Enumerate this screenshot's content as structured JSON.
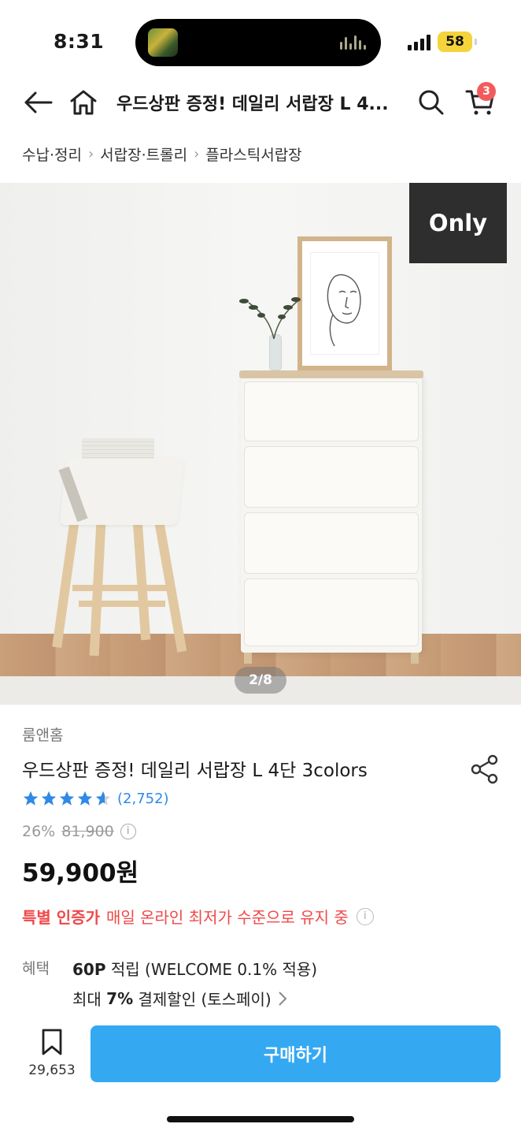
{
  "status_bar": {
    "time": "8:31",
    "battery": "58"
  },
  "header": {
    "title": "우드상판 증정! 데일리 서랍장 L 4...",
    "cart_count": "3"
  },
  "breadcrumb": [
    "수납·정리",
    "서랍장·트롤리",
    "플라스틱서랍장"
  ],
  "gallery": {
    "badge": "Only",
    "pager": "2/8"
  },
  "product": {
    "seller": "룸앤홈",
    "name": "우드상판 증정! 데일리 서랍장 L 4단 3colors",
    "rating": 4.5,
    "review_count": "(2,752)",
    "discount": "26%",
    "original_price": "81,900",
    "price": "59,900원",
    "promo_strong": "특별 인증가",
    "promo_text": "매일 온라인 최저가 수준으로 유지 중",
    "benefit_label": "혜택",
    "points_bold": "60P",
    "points_text": "적립 (WELCOME 0.1% 적용)",
    "payment_pre": "최대",
    "payment_bold": "7%",
    "payment_text": "결제할인 (토스페이)"
  },
  "bottom_bar": {
    "bookmark_count": "29,653",
    "buy_label": "구매하기"
  },
  "colors": {
    "accent": "#35a8f2",
    "promo": "#f04848",
    "star": "#2f89e6",
    "badge": "#f35b5b"
  }
}
